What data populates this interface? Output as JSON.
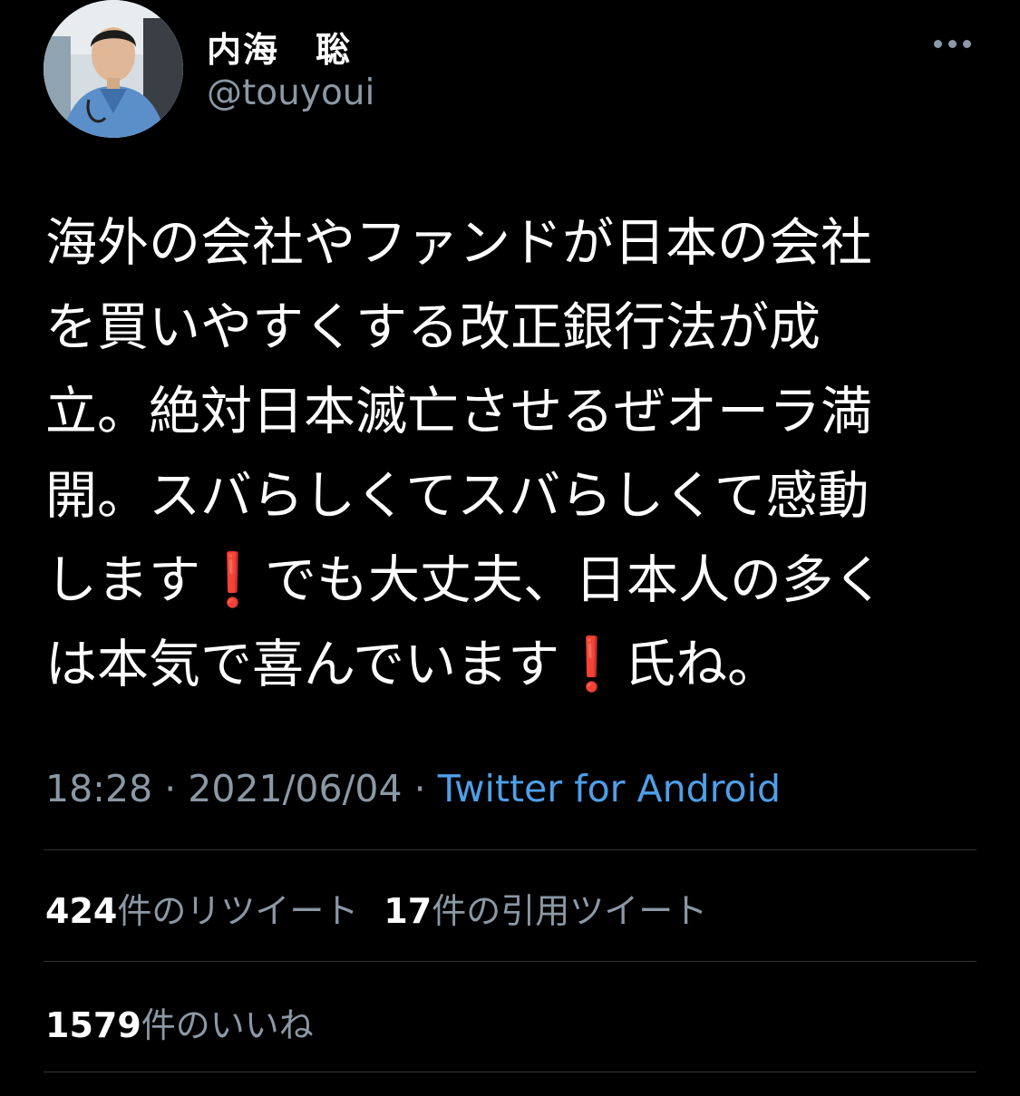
{
  "author": {
    "display_name": "内海　聡",
    "handle": "@touyoui"
  },
  "tweet": {
    "lines": [
      {
        "text": "海外の会社やファンドが日本の会社"
      },
      {
        "text": "を買いやすくする改正銀行法が成"
      },
      {
        "text": "立。絶対日本滅亡させるぜオーラ満"
      },
      {
        "text": "開。スバらしくてスバらしくて感動"
      },
      {
        "text_before": "します",
        "emoji": "❗",
        "text_after": "でも大丈夫、日本人の多く"
      },
      {
        "text_before": "は本気で喜んでいます",
        "emoji": "❗",
        "text_after": "氏ね。"
      }
    ]
  },
  "meta": {
    "time": "18:28",
    "separator": " · ",
    "date": "2021/06/04",
    "source": "Twitter for Android"
  },
  "stats": {
    "retweets_count": "424",
    "retweets_label": "件のリツイート",
    "quotes_count": "17",
    "quotes_label": "件の引用ツイート",
    "likes_count": "1579",
    "likes_label": "件のいいね"
  },
  "icons": {
    "more": "more-horizontal-icon"
  },
  "colors": {
    "background": "#000000",
    "text": "#ffffff",
    "secondary": "#8b98a5",
    "link": "#4f9fe8",
    "divider": "#2f3336",
    "emoji_red": "#e0242a"
  }
}
